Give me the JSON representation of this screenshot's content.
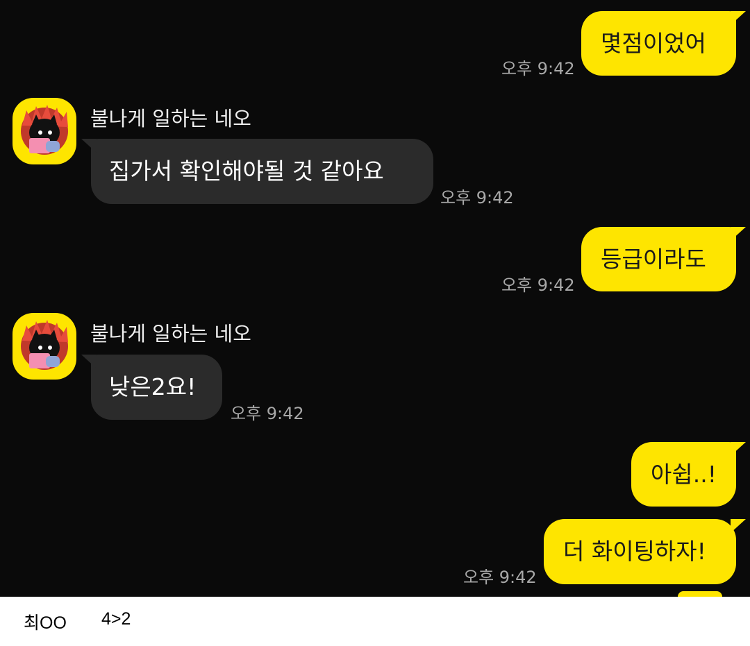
{
  "chat": {
    "sender_name": "불나게 일하는 네오",
    "messages": [
      {
        "from": "me",
        "text": "몇점이었어",
        "time": "오후 9:42"
      },
      {
        "from": "other",
        "text": "집가서 확인해야될 것 같아요",
        "time": "오후 9:42"
      },
      {
        "from": "me",
        "text": "등급이라도",
        "time": "오후 9:42"
      },
      {
        "from": "other",
        "text": "낮은2요!",
        "time": "오후 9:42"
      },
      {
        "from": "me",
        "text": "아쉽..!"
      },
      {
        "from": "me",
        "text": "더 화이팅하자!",
        "time": "오후 9:42"
      }
    ]
  },
  "caption": {
    "name": "최OO",
    "grade": "4>2"
  },
  "colors": {
    "background": "#0a0a0a",
    "sent_bubble": "#fee500",
    "received_bubble": "#2b2b2b",
    "timestamp": "#a8a8a8"
  },
  "avatar_icon": "neo-character-icon"
}
